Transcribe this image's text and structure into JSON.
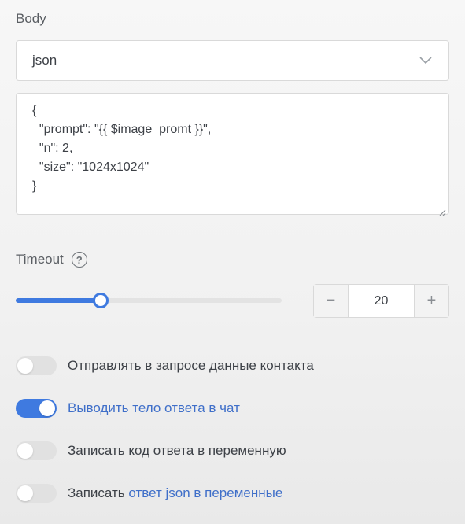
{
  "body_section": {
    "label": "Body",
    "format_select": {
      "value": "json",
      "icon": "chevron-down-icon"
    },
    "code_lines": [
      "{",
      "  \"prompt\": \"{{ $image_promt }}\",",
      "  \"n\": 2,",
      "  \"size\": \"1024x1024\"",
      "}"
    ]
  },
  "timeout": {
    "label": "Timeout",
    "help_glyph": "?",
    "slider_fraction": 0.32,
    "stepper": {
      "minus": "−",
      "value": "20",
      "plus": "+"
    }
  },
  "toggles": [
    {
      "label": "Отправлять в запросе данные контакта",
      "on": false
    },
    {
      "label": "Выводить тело ответа в чат",
      "on": true
    },
    {
      "label": "Записать код ответа в переменную",
      "on": false
    },
    {
      "label_parts": [
        "Записать ",
        "ответ json в переменные"
      ],
      "on": false
    }
  ],
  "colors": {
    "accent": "#3f7ae0",
    "accent_text": "#3f6fc9",
    "toggle_off": "#e1e1e1"
  }
}
